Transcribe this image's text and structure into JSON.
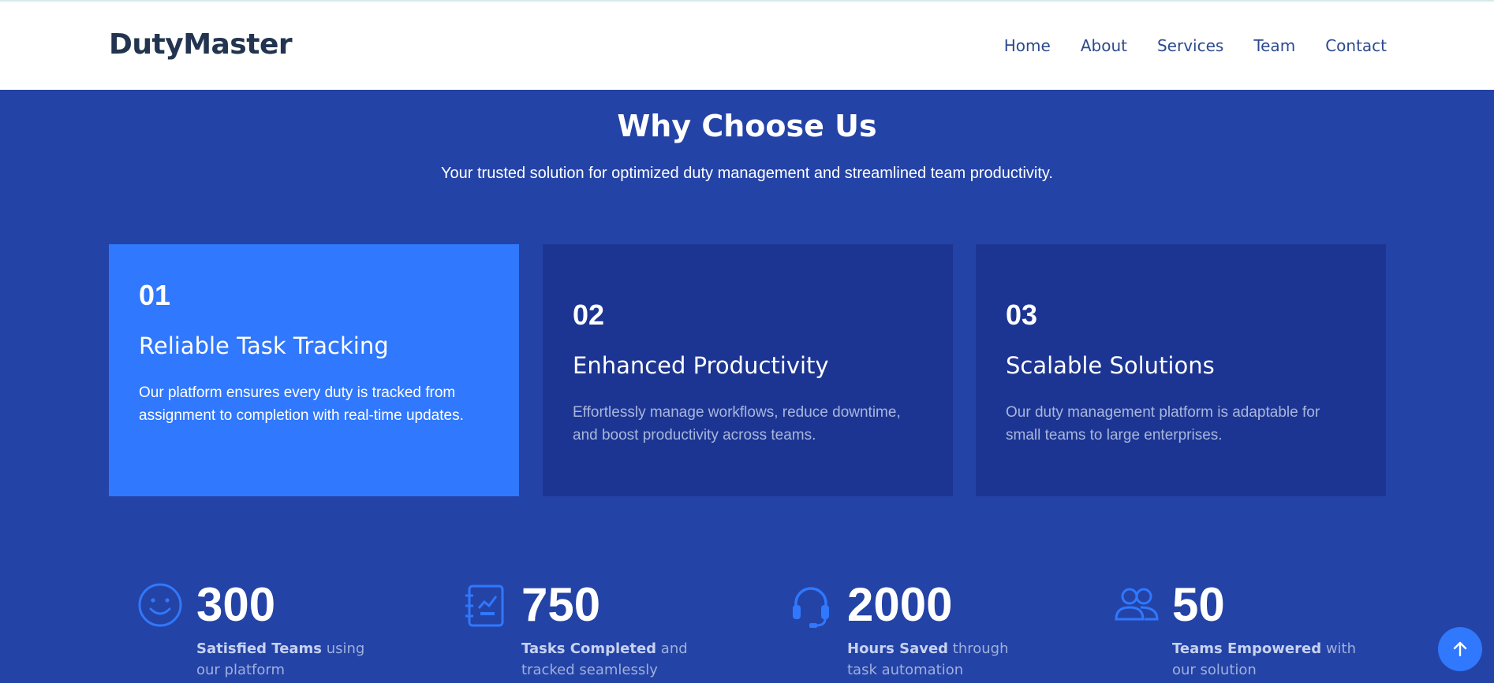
{
  "header": {
    "logo": "DutyMaster",
    "nav": [
      "Home",
      "About",
      "Services",
      "Team",
      "Contact"
    ]
  },
  "section": {
    "title": "Why Choose Us",
    "subtitle": "Your trusted solution for optimized duty management and streamlined team productivity."
  },
  "cards": [
    {
      "number": "01",
      "title": "Reliable Task Tracking",
      "description": "Our platform ensures every duty is tracked from assignment to completion with real-time updates."
    },
    {
      "number": "02",
      "title": "Enhanced Productivity",
      "description": "Effortlessly manage workflows, reduce downtime, and boost productivity across teams."
    },
    {
      "number": "03",
      "title": "Scalable Solutions",
      "description": "Our duty management platform is adaptable for small teams to large enterprises."
    }
  ],
  "stats": [
    {
      "value": "300",
      "bold": "Satisfied Teams",
      "rest": " using our platform",
      "icon": "smile-icon"
    },
    {
      "value": "750",
      "bold": "Tasks Completed",
      "rest": " and tracked seamlessly",
      "icon": "journal-chart-icon"
    },
    {
      "value": "2000",
      "bold": "Hours Saved",
      "rest": " through task automation",
      "icon": "headset-icon"
    },
    {
      "value": "50",
      "bold": "Teams Empowered",
      "rest": " with our solution",
      "icon": "people-icon"
    }
  ],
  "colors": {
    "background": "#2443a6",
    "card": "#1d3592",
    "accent": "#3078fd",
    "logo": "#22344f"
  },
  "scroll_top_icon": "arrow-up-icon"
}
